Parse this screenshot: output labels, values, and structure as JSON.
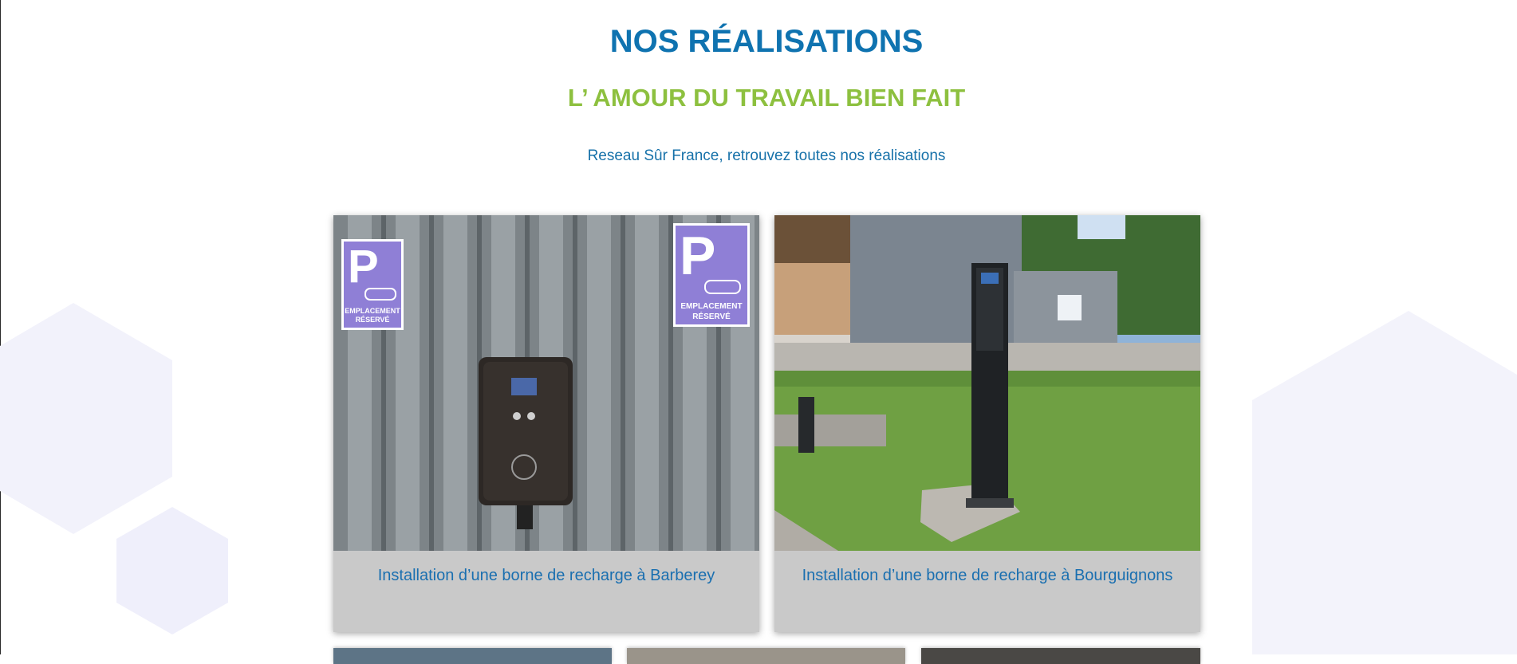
{
  "section": {
    "title": "NOS RÉALISATIONS",
    "subtitle": "L’ AMOUR DU TRAVAIL BIEN FAIT",
    "intro": "Reseau Sûr France, retrouvez toutes nos réalisations"
  },
  "cards": [
    {
      "caption": "Installation d’une borne de recharge à Barberey",
      "image": "wall-mounted-ev-charger-photo",
      "sign_text_1": "EMPLACEMENT",
      "sign_text_2": "RÉSERVÉ"
    },
    {
      "caption": "Installation d’une borne de recharge à Bourguignons",
      "image": "pedestal-ev-charger-photo"
    }
  ],
  "colors": {
    "title": "#0f73b0",
    "subtitle": "#8dc03f",
    "intro": "#1671a9",
    "card_bg": "#c9c9c9",
    "hexagon": "#f0f0fb"
  }
}
